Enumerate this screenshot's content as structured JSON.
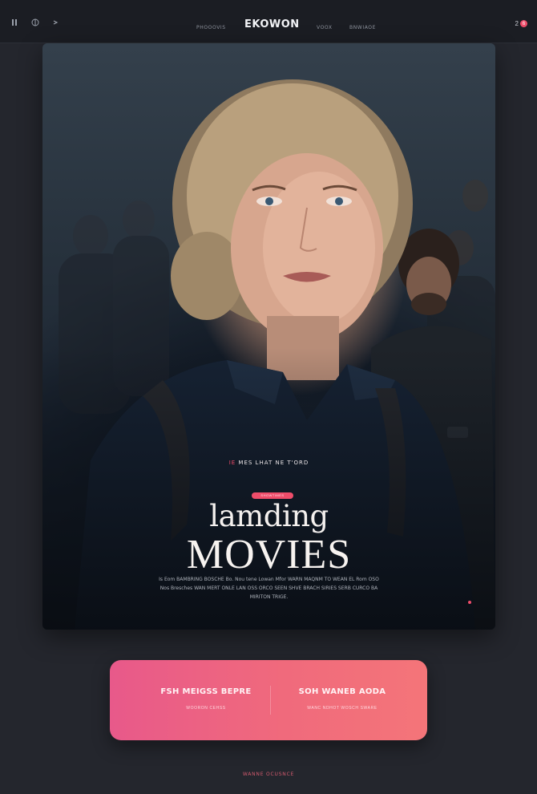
{
  "nav": {
    "brand": "EKOWON",
    "links": [
      "PHOOOVIS",
      "VOOX",
      "BNWIAOE"
    ],
    "notification_count": "2",
    "notification_badge": "6",
    "icons": [
      "menu-icon",
      "globe-icon",
      "arrow-icon"
    ]
  },
  "hero": {
    "kicker_mark": "IE",
    "kicker": "MES LHAT NE T'ORD",
    "pill": "SHOWTIMES",
    "title_script": "lamding",
    "title_big": "MOVIES",
    "description": "Is Eom BAMBRING BOSCHE Bo. Nou tene Lowan Mfor WARN MAQNM TO WEAN EL Rom OSO Nos Bresches WAN MERT ONLE LAN OSS ORCO SEEN SHVE BRACH SIRIES SERB CURCO BA MIRITON TRIGE."
  },
  "cta": {
    "left_title": "FSH MEIGSS BEPRE",
    "left_sub": "WOORON CEHSS",
    "right_title": "SOH WANEB AODA",
    "right_sub": "WANC NDHOT WOSCH SWARE"
  },
  "footer": {
    "text": "WANNE OCUSNCE"
  },
  "colors": {
    "accent": "#ef4d6a",
    "background": "#24262d",
    "cta_start": "#e8598a",
    "cta_end": "#f47579"
  }
}
